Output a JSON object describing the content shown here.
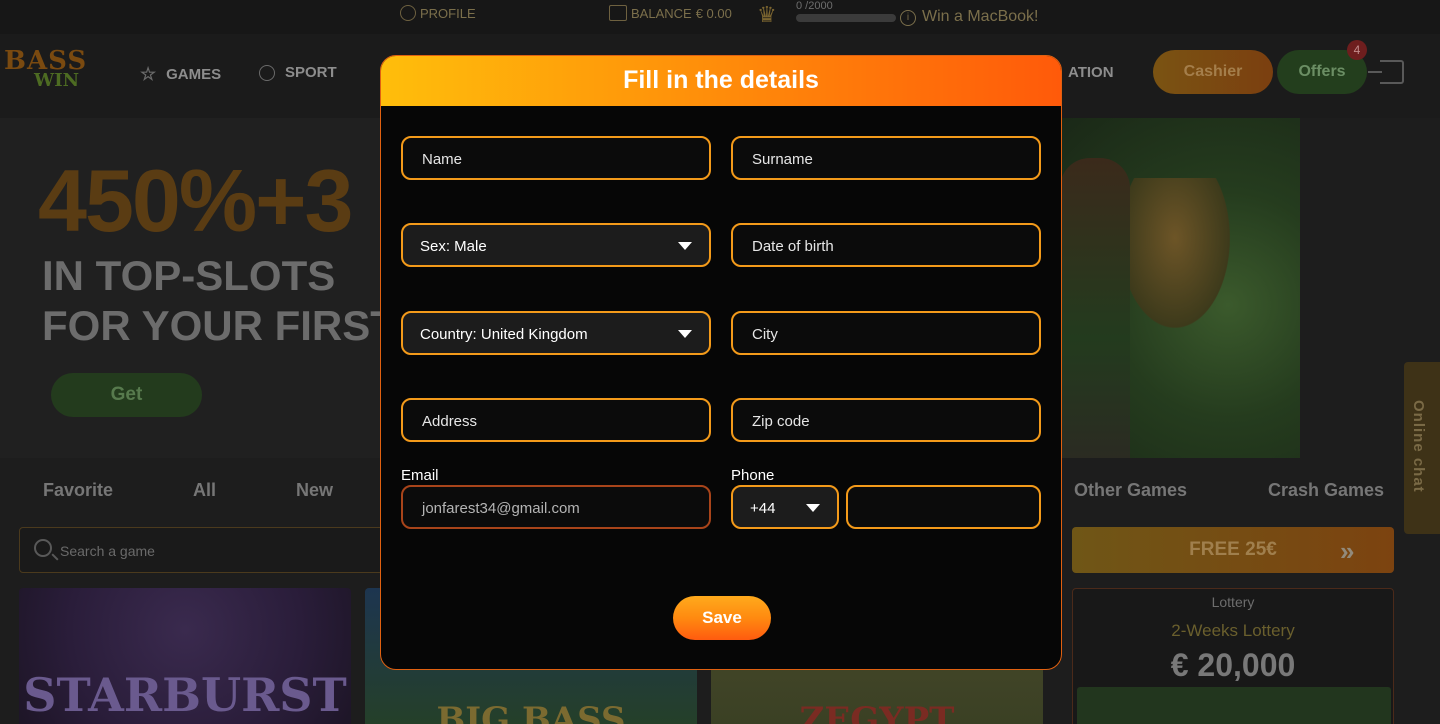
{
  "topbar": {
    "profile_label": "PROFILE",
    "balance_label": "BALANCE",
    "balance_value": "€ 0.00",
    "progress_text": "0 /2000",
    "progress_fraction": 0,
    "macbook_text": "Win a MacBook!"
  },
  "logo": {
    "line1": "BASS",
    "line2": "WIN"
  },
  "nav": {
    "games": "GAMES",
    "sport": "SPORT",
    "partial_right": "ATION",
    "cashier": "Cashier",
    "offers": "Offers",
    "offers_badge": "4"
  },
  "banner": {
    "big": "450%+3",
    "line1": "IN TOP-SLOTS",
    "line2": "FOR YOUR FIRST",
    "cta": "Get"
  },
  "chat_tab": "Online chat",
  "categories": [
    "Favorite",
    "All",
    "New",
    "Other Games",
    "Crash Games"
  ],
  "search": {
    "placeholder": "Search a game"
  },
  "free_banner": {
    "label": "FREE 25€"
  },
  "lottery": {
    "label": "Lottery",
    "title": "2-Weeks Lottery",
    "amount": "€ 20,000"
  },
  "games": [
    "STARBURST",
    "BIG BASS",
    "ZEGYPT"
  ],
  "modal": {
    "title": "Fill in the details",
    "fields": {
      "name_placeholder": "Name",
      "surname_placeholder": "Surname",
      "sex_value": "Sex: Male",
      "dob_placeholder": "Date of birth",
      "country_value": "Country: United Kingdom",
      "city_placeholder": "City",
      "address_placeholder": "Address",
      "zip_placeholder": "Zip code",
      "email_label": "Email",
      "email_value": "jonfarest34@gmail.com",
      "phone_label": "Phone",
      "phone_code": "+44",
      "phone_number": ""
    },
    "save": "Save"
  },
  "colors": {
    "accent_orange": "#ff8c0a",
    "header_gradient_start": "#ffbe0b",
    "header_gradient_end": "#ff5a0a",
    "field_border": "#f26b0f"
  }
}
